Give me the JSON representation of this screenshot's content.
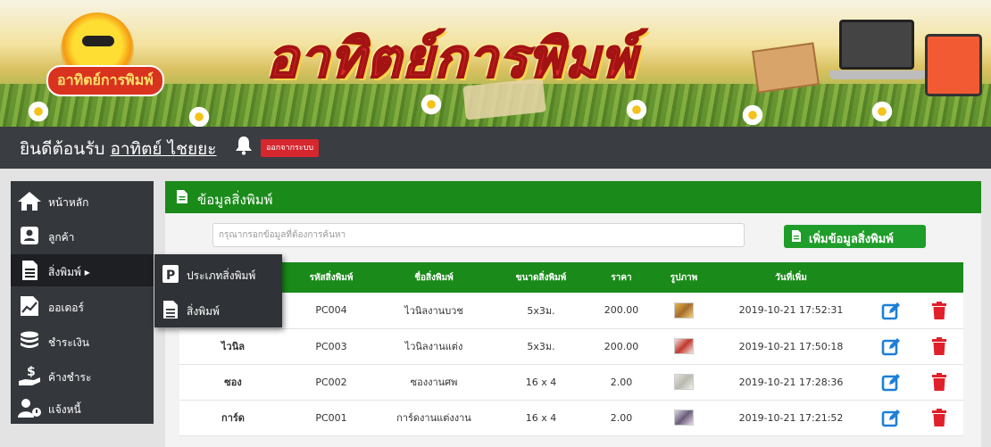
{
  "banner": {
    "logo_text": "อาทิตย์การพิมพ์",
    "title": "อาทิตย์การพิมพ์"
  },
  "topbar": {
    "welcome": "ยินดีต้อนรับ",
    "username": "อาทิตย์ ไชยยะ",
    "logout_label": "ออกจากระบบ"
  },
  "sidebar": {
    "items": [
      {
        "label": "หน้าหลัก",
        "icon": "home-icon"
      },
      {
        "label": "ลูกค้า",
        "icon": "contact-card-icon"
      },
      {
        "label": "สิ่งพิมพ์ ▸",
        "icon": "document-icon"
      },
      {
        "label": "ออเดอร์",
        "icon": "chart-icon"
      },
      {
        "label": "ชำระเงิน",
        "icon": "coins-icon"
      },
      {
        "label": "ค้างชำระ",
        "icon": "hand-dollar-icon"
      },
      {
        "label": "แจ้งหนี้",
        "icon": "user-notify-icon"
      }
    ]
  },
  "submenu": {
    "items": [
      {
        "label": "ประเภทสิ่งพิมพ์",
        "icon": "p-parking-icon"
      },
      {
        "label": "สิ่งพิมพ์",
        "icon": "document-icon"
      }
    ]
  },
  "panel": {
    "title": "ข้อมูลสิ่งพิมพ์",
    "search_placeholder": "กรุณากรอกข้อมูลที่ต้องการค้นหา",
    "add_label": "เพิ่มข้อมูลสิ่งพิมพ์"
  },
  "table": {
    "headers": [
      "",
      "รหัสสิ่งพิมพ์",
      "ชื่อสิ่งพิมพ์",
      "ขนาดสิ่งพิมพ์",
      "ราคา",
      "รูปภาพ",
      "วันที่เพิ่ม",
      "",
      ""
    ],
    "rows": [
      {
        "type": "",
        "code": "PC004",
        "name": "ไวนิลงานบวช",
        "size": "5x3ม.",
        "price": "200.00",
        "date": "2019-10-21 17:52:31"
      },
      {
        "type": "ไวนิล",
        "code": "PC003",
        "name": "ไวนิลงานแต่ง",
        "size": "5x3ม.",
        "price": "200.00",
        "date": "2019-10-21 17:50:18"
      },
      {
        "type": "ซอง",
        "code": "PC002",
        "name": "ซองงานศพ",
        "size": "16 x 4",
        "price": "2.00",
        "date": "2019-10-21 17:28:36"
      },
      {
        "type": "การ์ด",
        "code": "PC001",
        "name": "การ์ดงานแต่งงาน",
        "size": "16 x 4",
        "price": "2.00",
        "date": "2019-10-21 17:21:52"
      }
    ]
  },
  "colors": {
    "accent_green": "#1a8a1a",
    "sidebar_bg": "#34373c",
    "logout_red": "#d6262e",
    "edit_blue": "#1e7fd8",
    "delete_red": "#e0202a"
  }
}
